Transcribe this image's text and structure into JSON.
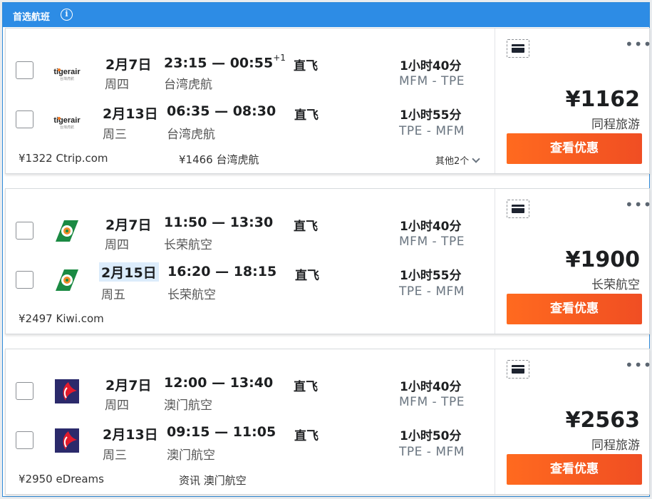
{
  "header": {
    "title": "首选航班",
    "info_icon": "i"
  },
  "results": [
    {
      "outbound": {
        "date": "2月7日",
        "weekday": "周四",
        "times": "23:15 — 00:55",
        "day_offset": "+1",
        "airline": "台湾虎航",
        "stops": "直飞",
        "duration": "1小时40分",
        "route": "MFM - TPE"
      },
      "inbound": {
        "date": "2月13日",
        "weekday": "周三",
        "times": "06:35 — 08:30",
        "airline": "台湾虎航",
        "stops": "直飞",
        "duration": "1小时55分",
        "route": "TPE - MFM"
      },
      "logo_name": "tigerair",
      "alt_prices": [
        "¥1322 Ctrip.com",
        "¥1466 台湾虎航"
      ],
      "more_label": "其他2个",
      "price": "¥1162",
      "provider": "同程旅游",
      "cta": "查看优惠"
    },
    {
      "outbound": {
        "date": "2月7日",
        "weekday": "周四",
        "times": "11:50 — 13:30",
        "airline": "长荣航空",
        "stops": "直飞",
        "duration": "1小时40分",
        "route": "MFM - TPE"
      },
      "inbound": {
        "date": "2月15日",
        "weekday": "周五",
        "times": "16:20 — 18:15",
        "airline": "长荣航空",
        "stops": "直飞",
        "duration": "1小时55分",
        "route": "TPE - MFM"
      },
      "logo_name": "eva-air",
      "alt_prices": [
        "¥2497 Kiwi.com"
      ],
      "price": "¥1900",
      "provider": "长荣航空",
      "cta": "查看优惠"
    },
    {
      "outbound": {
        "date": "2月7日",
        "weekday": "周四",
        "times": "12:00 — 13:40",
        "airline": "澳门航空",
        "stops": "直飞",
        "duration": "1小时40分",
        "route": "MFM - TPE"
      },
      "inbound": {
        "date": "2月13日",
        "weekday": "周三",
        "times": "09:15 — 11:05",
        "airline": "澳门航空",
        "stops": "直飞",
        "duration": "1小时50分",
        "route": "TPE - MFM"
      },
      "logo_name": "air-macau",
      "alt_prices": [
        "¥2950 eDreams",
        "资讯 澳门航空"
      ],
      "price": "¥2563",
      "provider": "同程旅游",
      "cta": "查看优惠"
    }
  ],
  "colors": {
    "header": "#2d8ce5",
    "cta": "#f25a21",
    "highlight_date": "#dcecfb"
  }
}
